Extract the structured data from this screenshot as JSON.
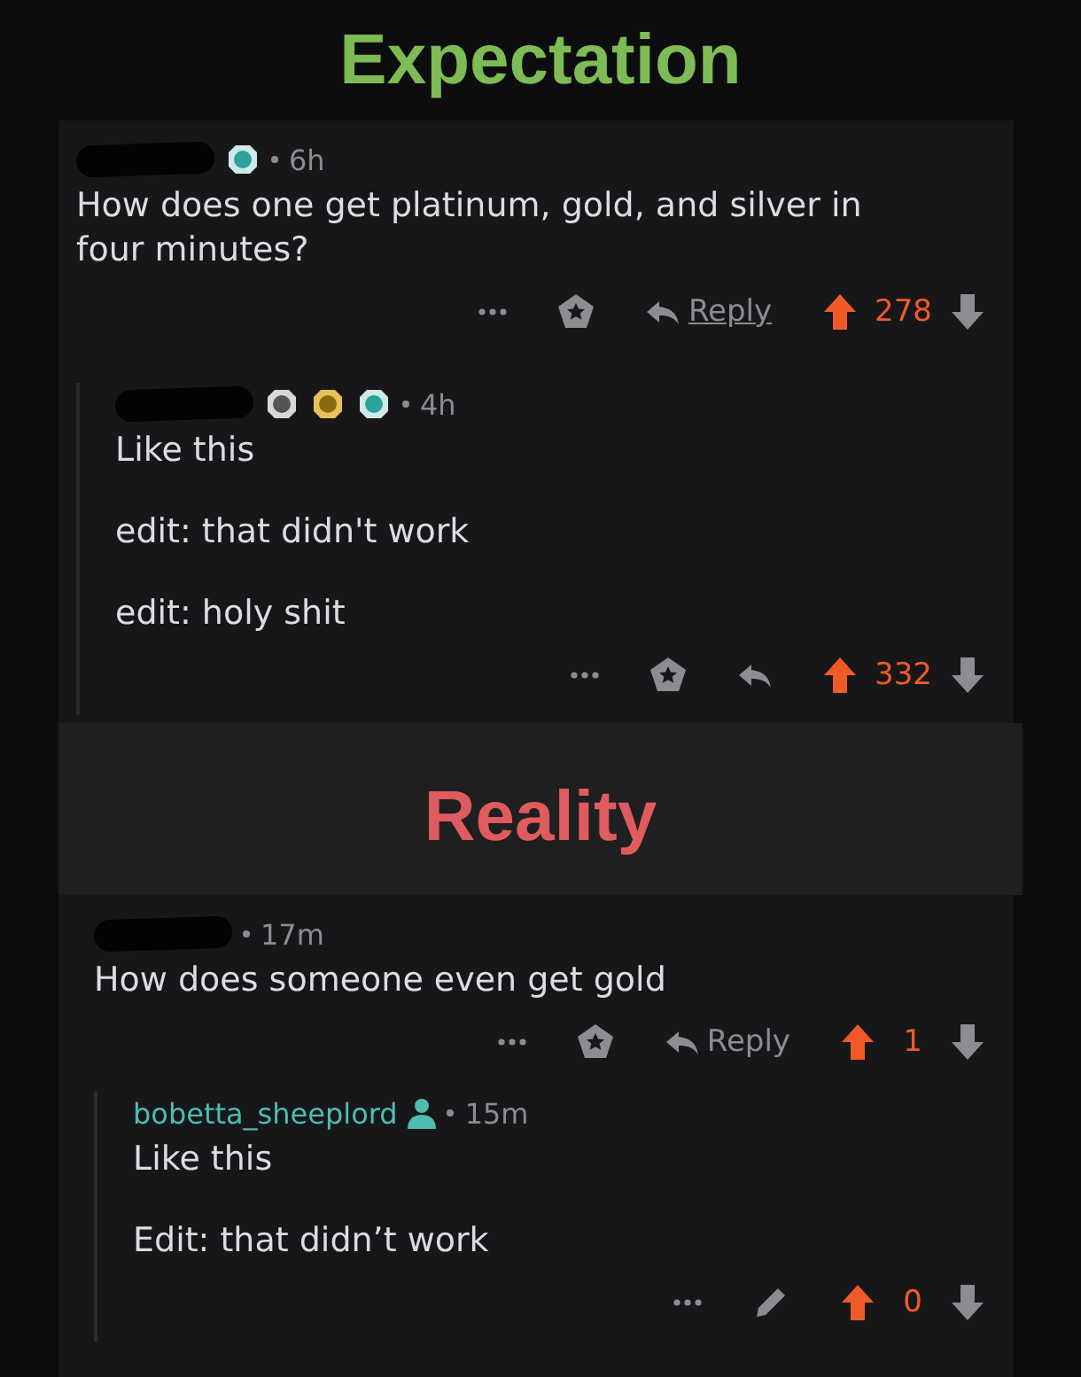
{
  "sections": [
    {
      "title": "Expectation",
      "color": "#7dbb54",
      "comments": [
        {
          "awards": [
            {
              "kind": "platinum"
            }
          ],
          "time": "6h",
          "body": [
            "How does one get platinum, gold, and silver in four minutes?"
          ],
          "tool": {
            "kind": "award"
          },
          "reply": {
            "kind": "labeled",
            "label": "Reply",
            "underlined": true
          },
          "upvoted": true,
          "score": "278",
          "replies": [
            {
              "awards": [
                {
                  "kind": "silver"
                },
                {
                  "kind": "gold"
                },
                {
                  "kind": "platinum"
                }
              ],
              "time": "4h",
              "body": [
                "Like this",
                "edit: that didn't work",
                "edit: holy shit"
              ],
              "tool": {
                "kind": "award"
              },
              "reply": {
                "kind": "icon"
              },
              "upvoted": true,
              "score": "332"
            }
          ]
        }
      ]
    },
    {
      "title": "Reality",
      "color": "#e05b5e",
      "comments": [
        {
          "time": "17m",
          "body": [
            "How does someone even get gold"
          ],
          "tool": {
            "kind": "award"
          },
          "reply": {
            "kind": "labeled",
            "label": "Reply",
            "underlined": false
          },
          "upvoted": true,
          "score": "1",
          "replies": [
            {
              "author": "bobetta_sheeplord",
              "time": "15m",
              "body": [
                "Like this",
                "Edit: that didn’t work"
              ],
              "tool": {
                "kind": "edit"
              },
              "upvoted": true,
              "score": "0"
            }
          ]
        }
      ]
    }
  ]
}
